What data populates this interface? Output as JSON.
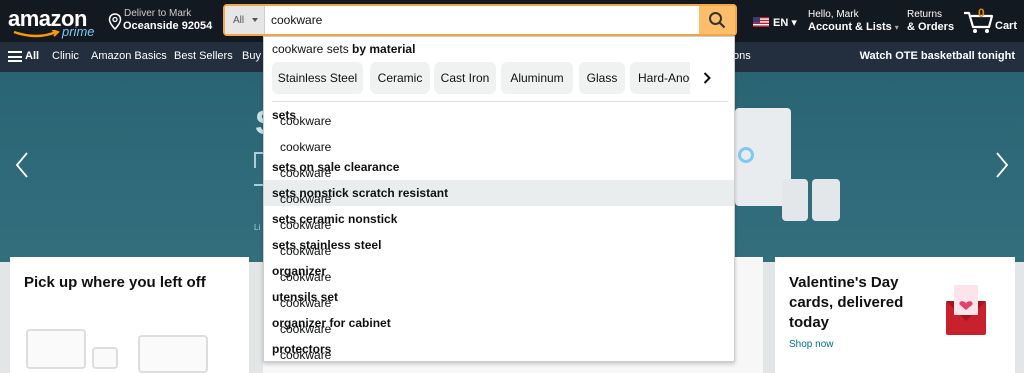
{
  "header": {
    "logo_text": "amazon",
    "logo_sub": "prime",
    "deliver_line1": "Deliver to Mark",
    "deliver_line2": "Oceanside 92054",
    "search_category": "All",
    "search_value": "cookware",
    "language": "EN",
    "account_line1": "Hello, Mark",
    "account_line2": "Account & Lists",
    "returns_line1": "Returns",
    "returns_line2": "& Orders",
    "cart_count": "0",
    "cart_label": "Cart"
  },
  "subnav": {
    "all_label": "All",
    "items": [
      "Clinic",
      "Amazon Basics",
      "Best Sellers",
      "Buy A"
    ],
    "trailing_fragment": "ons",
    "promo": "Watch OTE basketball tonight"
  },
  "hero": {
    "text_fragment": "S",
    "small_fragment": "Li"
  },
  "dropdown": {
    "heading_prefix": "cookware sets ",
    "heading_bold": "by material",
    "chips": [
      "Stainless Steel",
      "Ceramic",
      "Cast Iron",
      "Aluminum",
      "Glass",
      "Hard-Anod"
    ],
    "suggestions": [
      {
        "prefix": "cookware ",
        "bold": "sets"
      },
      {
        "prefix": "cookware",
        "bold": ""
      },
      {
        "prefix": "cookware ",
        "bold": "sets on sale clearance"
      },
      {
        "prefix": "cookware ",
        "bold": "sets nonstick scratch resistant"
      },
      {
        "prefix": "cookware ",
        "bold": "sets ceramic nonstick"
      },
      {
        "prefix": "cookware ",
        "bold": "sets stainless steel"
      },
      {
        "prefix": "cookware ",
        "bold": "organizer"
      },
      {
        "prefix": "cookware ",
        "bold": "utensils set"
      },
      {
        "prefix": "cookware ",
        "bold": "organizer for cabinet"
      },
      {
        "prefix": "cookware ",
        "bold": "protectors"
      }
    ],
    "highlighted_index": 3
  },
  "cards": {
    "left_title": "Pick up where you left off",
    "right_title": "Valentine's Day cards, delivered today",
    "right_link": "Shop now"
  },
  "colors": {
    "nav_top": "#131921",
    "nav_sub": "#232f3e",
    "search_accent": "#febd69",
    "cart_count": "#f08804",
    "link": "#007185"
  },
  "icons": [
    "location-pin-icon",
    "search-icon",
    "us-flag-icon",
    "cart-icon",
    "hamburger-icon",
    "chevron-left-icon",
    "chevron-right-icon"
  ]
}
